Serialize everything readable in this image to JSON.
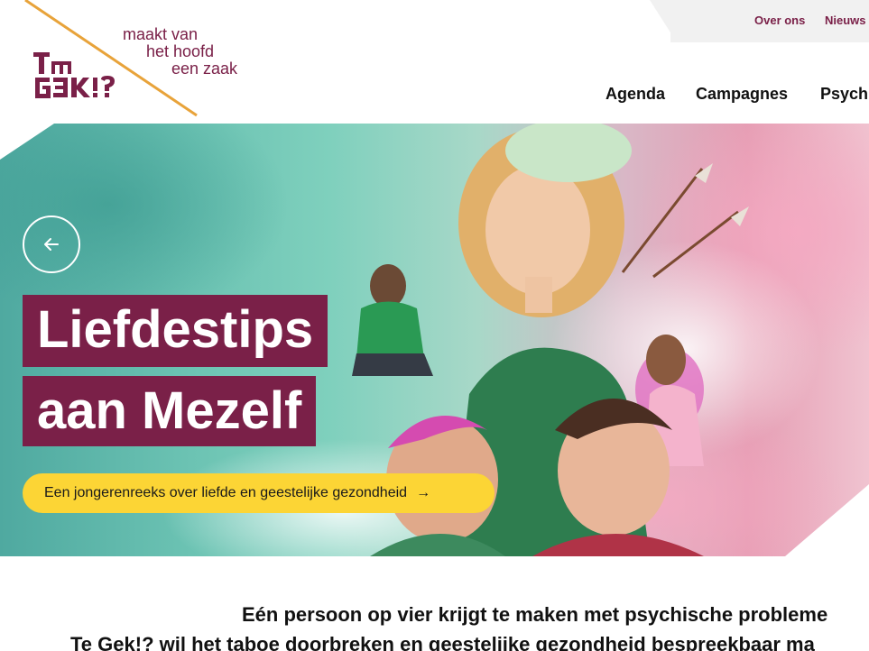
{
  "brand": {
    "tagline_lines": [
      "maakt van",
      "het hoofd",
      "een zaak"
    ],
    "logo_alt": "Te Gek!?",
    "colors": {
      "primary": "#7a2048",
      "accent": "#fcd535",
      "diagonal": "#e8a33a"
    }
  },
  "topbar": {
    "links": [
      "Over ons",
      "Nieuws"
    ]
  },
  "nav": {
    "items": [
      "Agenda",
      "Campagnes",
      "Psych"
    ]
  },
  "hero": {
    "title_lines": [
      "Liefdestips",
      "aan Mezelf"
    ],
    "cta_label": "Een jongerenreeks over liefde en geestelijke gezondheid",
    "cta_arrow": "→",
    "back_icon": "arrow-left-icon"
  },
  "intro": {
    "line1": "Eén persoon op vier krijgt te maken met psychische probleme",
    "line2": "Te Gek!? wil het taboe doorbreken en geestelijke gezondheid bespreekbaar ma"
  }
}
